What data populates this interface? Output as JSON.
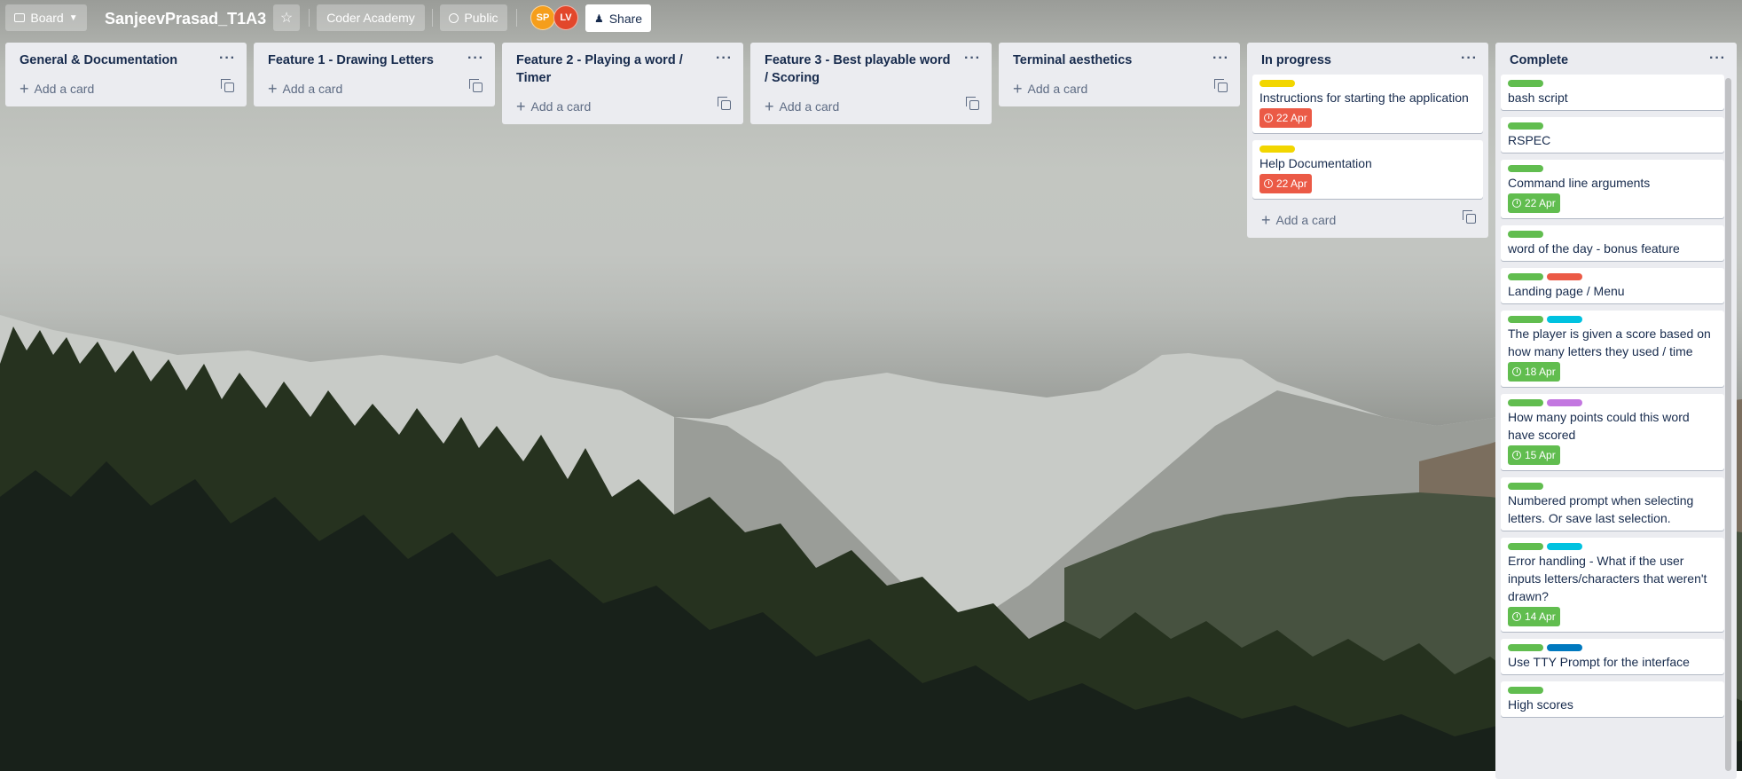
{
  "board": {
    "view_label": "Board",
    "title": "SanjeevPrasad_T1A3",
    "workspace": "Coder Academy",
    "visibility": "Public",
    "share_label": "Share",
    "members": [
      {
        "initials": "SP",
        "color": "#f59e1b"
      },
      {
        "initials": "LV",
        "color": "#e2472b"
      }
    ]
  },
  "add_card_label": "Add a card",
  "lists": [
    {
      "title": "General & Documentation",
      "cards": []
    },
    {
      "title": "Feature 1 - Drawing Letters",
      "cards": []
    },
    {
      "title": "Feature 2 - Playing a word / Timer",
      "cards": []
    },
    {
      "title": "Feature 3 - Best playable word / Scoring",
      "cards": []
    },
    {
      "title": "Terminal aesthetics",
      "cards": []
    },
    {
      "title": "In progress",
      "cards": [
        {
          "labels": [
            "#f2d600"
          ],
          "text": "Instructions for starting the application",
          "due": "22 Apr",
          "due_status": "overdue"
        },
        {
          "labels": [
            "#f2d600"
          ],
          "text": "Help Documentation",
          "due": "22 Apr",
          "due_status": "overdue"
        }
      ]
    },
    {
      "title": "Complete",
      "cards": [
        {
          "labels": [
            "#61bd4f"
          ],
          "text": "bash script"
        },
        {
          "labels": [
            "#61bd4f"
          ],
          "text": "RSPEC"
        },
        {
          "labels": [
            "#61bd4f"
          ],
          "text": "Command line arguments",
          "due": "22 Apr",
          "due_status": "complete"
        },
        {
          "labels": [
            "#61bd4f"
          ],
          "text": "word of the day - bonus feature"
        },
        {
          "labels": [
            "#61bd4f",
            "#eb5a46"
          ],
          "text": "Landing page / Menu"
        },
        {
          "labels": [
            "#61bd4f",
            "#00c2e0"
          ],
          "text": "The player is given a score based on how many letters they used / time",
          "due": "18 Apr",
          "due_status": "complete"
        },
        {
          "labels": [
            "#61bd4f",
            "#c377e0"
          ],
          "text": "How many points could this word have scored",
          "due": "15 Apr",
          "due_status": "complete"
        },
        {
          "labels": [
            "#61bd4f"
          ],
          "text": "Numbered prompt when selecting letters. Or save last selection."
        },
        {
          "labels": [
            "#61bd4f",
            "#00c2e0"
          ],
          "text": "Error handling - What if the user inputs letters/characters that weren't drawn?",
          "due": "14 Apr",
          "due_status": "complete"
        },
        {
          "labels": [
            "#61bd4f",
            "#0079bf"
          ],
          "text": "Use TTY Prompt for the interface"
        },
        {
          "labels": [
            "#61bd4f"
          ],
          "text": "High scores"
        }
      ]
    }
  ],
  "colors": {
    "overdue": "#eb5a46",
    "complete": "#61bd4f"
  }
}
